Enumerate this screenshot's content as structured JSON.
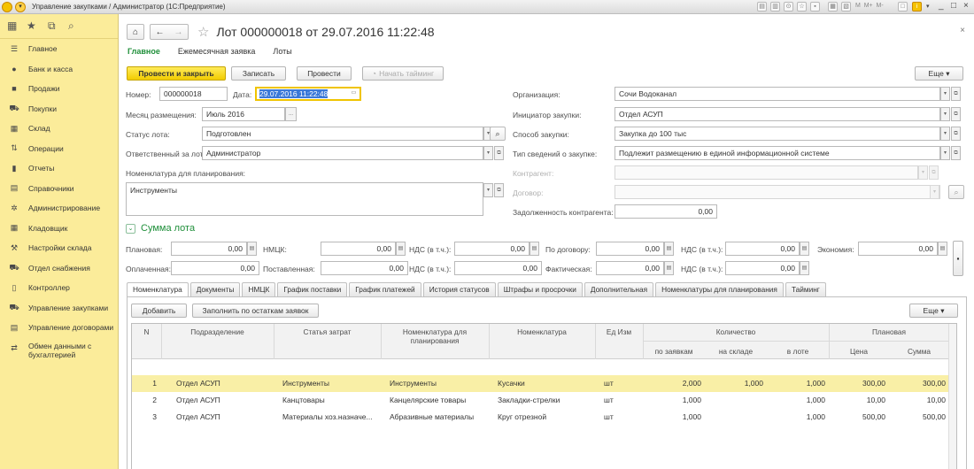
{
  "window": {
    "title": "Управление закупками / Администратор  (1С:Предприятие)",
    "controls": [
      "_",
      "□",
      "×"
    ]
  },
  "sidebar": {
    "items": [
      {
        "label": "Главное",
        "icon": "menu-icon"
      },
      {
        "label": "Банк и касса",
        "icon": "coin-icon"
      },
      {
        "label": "Продажи",
        "icon": "bag-icon"
      },
      {
        "label": "Покупки",
        "icon": "cart-icon"
      },
      {
        "label": "Склад",
        "icon": "warehouse-icon"
      },
      {
        "label": "Операции",
        "icon": "operations-icon"
      },
      {
        "label": "Отчеты",
        "icon": "report-icon"
      },
      {
        "label": "Справочники",
        "icon": "book-icon"
      },
      {
        "label": "Администрирование",
        "icon": "gear-icon"
      },
      {
        "label": "Кладовщик",
        "icon": "grid-icon"
      },
      {
        "label": "Настройки склада",
        "icon": "wrench-icon"
      },
      {
        "label": "Отдел снабжения",
        "icon": "cart-icon"
      },
      {
        "label": "Контроллер",
        "icon": "doc-icon"
      },
      {
        "label": "Управление закупками",
        "icon": "cart-icon"
      },
      {
        "label": "Управление договорами",
        "icon": "doc-icon"
      },
      {
        "label": "Обмен данными с бухгалтерией",
        "icon": "exchange-icon"
      }
    ]
  },
  "header": {
    "title": "Лот 000000018 от 29.07.2016 11:22:48"
  },
  "topTabs": [
    "Главное",
    "Ежемесячная заявка",
    "Лоты"
  ],
  "toolbar": {
    "post_close": "Провести и закрыть",
    "save": "Записать",
    "post": "Провести",
    "timing": "Начать тайминг",
    "more": "Еще"
  },
  "form": {
    "number_label": "Номер:",
    "number": "000000018",
    "date_label": "Дата:",
    "date": "29.07.2016 11:22:48",
    "month_label": "Месяц размещения:",
    "month": "Июль 2016",
    "status_label": "Статус лота:",
    "status": "Подготовлен",
    "resp_label": "Ответственный за лот",
    "resp": "Администратор",
    "nom_plan_label": "Номенклатура для планирования:",
    "nom_plan": "Инструменты",
    "org_label": "Организация:",
    "org": "Сочи Водоканал",
    "init_label": "Инициатор закупки:",
    "init": "Отдел АСУП",
    "method_label": "Способ закупки:",
    "method": "Закупка до 100 тыс",
    "info_label": "Тип сведений о закупке:",
    "info": "Подлежит размещению в единой информационной системе",
    "contractor_label": "Контрагент:",
    "contract_label": "Договор:",
    "debt_label": "Задолженность контрагента:",
    "debt": "0,00"
  },
  "sum": {
    "title": "Сумма лота",
    "planned_label": "Плановая:",
    "planned": "0,00",
    "nmck_label": "НМЦК:",
    "nmck": "0,00",
    "vat1_label": "НДС (в т.ч.):",
    "vat1": "0,00",
    "contract_label": "По договору:",
    "contract": "0,00",
    "vat2_label": "НДС (в т.ч.):",
    "vat2": "0,00",
    "economy_label": "Экономия:",
    "economy": "0,00",
    "paid_label": "Оплаченная:",
    "paid": "0,00",
    "delivered_label": "Поставленная:",
    "delivered": "0,00",
    "vat3_label": "НДС (в т.ч.):",
    "vat3": "0,00",
    "actual_label": "Фактическая:",
    "actual": "0,00",
    "vat4_label": "НДС (в т.ч.):",
    "vat4": "0,00"
  },
  "tabs": [
    "Номенклатура",
    "Документы",
    "НМЦК",
    "График поставки",
    "График платежей",
    "История статусов",
    "Штрафы и просрочки",
    "Дополнительная",
    "Номенклатуры для планирования",
    "Тайминг"
  ],
  "tableToolbar": {
    "add": "Добавить",
    "fill": "Заполнить по остаткам заявок",
    "more": "Еще"
  },
  "table": {
    "headers": {
      "n": "N",
      "dept": "Подразделение",
      "cost": "Статья затрат",
      "nomplan": "Номенклатура для планирования",
      "nom": "Номенклатура",
      "unit": "Ед Изм",
      "qty": "Количество",
      "byreq": "по заявкам",
      "stock": "на складе",
      "lot": "в лоте",
      "plan": "Плановая",
      "price": "Цена",
      "sum": "Сумма"
    },
    "rows": [
      {
        "n": "1",
        "dept": "Отдел АСУП",
        "cost": "Инструменты",
        "nomplan": "Инструменты",
        "nom": "Кусачки",
        "unit": "шт",
        "byreq": "2,000",
        "stock": "1,000",
        "lot": "1,000",
        "price": "300,00",
        "sum": "300,00"
      },
      {
        "n": "2",
        "dept": "Отдел АСУП",
        "cost": "Канцтовары",
        "nomplan": "Канцелярские товары",
        "nom": "Закладки-стрелки",
        "unit": "шт",
        "byreq": "1,000",
        "stock": "",
        "lot": "1,000",
        "price": "10,00",
        "sum": "10,00"
      },
      {
        "n": "3",
        "dept": "Отдел АСУП",
        "cost": "Материалы хоз.назначе...",
        "nomplan": "Абразивные материалы",
        "nom": "Круг отрезной",
        "unit": "шт",
        "byreq": "1,000",
        "stock": "",
        "lot": "1,000",
        "price": "500,00",
        "sum": "500,00"
      }
    ]
  }
}
